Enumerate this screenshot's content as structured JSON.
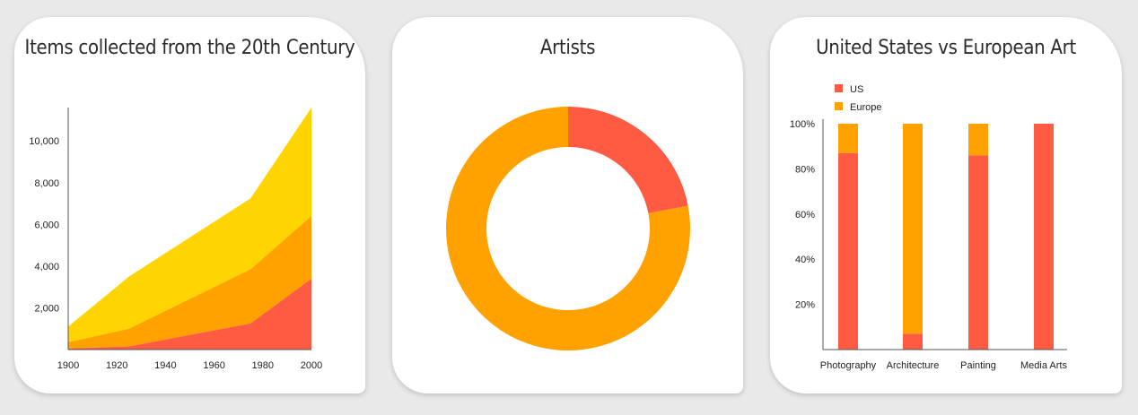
{
  "colors": {
    "red": "#ff5a42",
    "orange": "#ffa200",
    "yellow": "#ffd400",
    "axis": "#555555"
  },
  "cards": [
    {
      "title": "Items collected from the 20th Century"
    },
    {
      "title": "Artists"
    },
    {
      "title": "United States vs European Art"
    }
  ],
  "chart_data": [
    {
      "type": "area",
      "stacked": true,
      "title": "Items collected from the 20th Century",
      "x": [
        1900,
        1925,
        1975,
        2000
      ],
      "series": [
        {
          "color": "#ff5a42",
          "values": [
            50,
            150,
            1250,
            3400
          ]
        },
        {
          "color": "#ffa200",
          "values": [
            300,
            850,
            2600,
            3000
          ]
        },
        {
          "color": "#ffd400",
          "values": [
            750,
            2500,
            3400,
            5200
          ]
        }
      ],
      "xticks": [
        "1900",
        "1920",
        "1940",
        "1960",
        "1980",
        "2000"
      ],
      "xtick_values": [
        1900,
        1920,
        1940,
        1960,
        1980,
        2000
      ],
      "yticks": [
        "2,000",
        "4,000",
        "6,000",
        "8,000",
        "10,000"
      ],
      "ytick_values": [
        2000,
        4000,
        6000,
        8000,
        10000
      ],
      "xlim": [
        1900,
        2000
      ],
      "ylim": [
        0,
        11600
      ],
      "grid": false,
      "legend": "none"
    },
    {
      "type": "pie",
      "donut": true,
      "title": "Artists",
      "slices": [
        {
          "color": "#ff5a42",
          "value": 22
        },
        {
          "color": "#ffa200",
          "value": 78
        }
      ],
      "legend": "none"
    },
    {
      "type": "bar",
      "stacked": true,
      "percent": true,
      "title": "United States vs European Art",
      "categories": [
        "Photography",
        "Architecture",
        "Painting",
        "Media Arts"
      ],
      "series": [
        {
          "name": "US",
          "color": "#ff5a42",
          "values": [
            87,
            7,
            86,
            100
          ]
        },
        {
          "name": "Europe",
          "color": "#ffa200",
          "values": [
            13,
            93,
            14,
            0
          ]
        }
      ],
      "yticks": [
        "20%",
        "40%",
        "60%",
        "80%",
        "100%"
      ],
      "ytick_values": [
        20,
        40,
        60,
        80,
        100
      ],
      "ylim": [
        0,
        100
      ],
      "grid": false,
      "legend": "top-left"
    }
  ]
}
